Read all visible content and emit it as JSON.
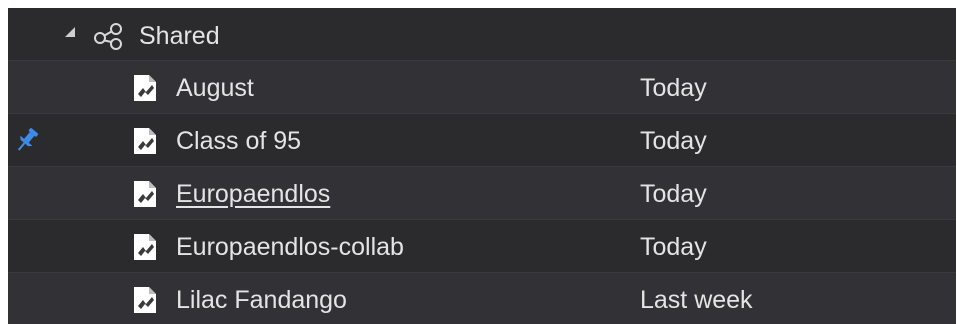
{
  "group": {
    "label": "Shared",
    "disclosure_icon": "triangle-expanded",
    "icon": "share-icon",
    "expanded": true
  },
  "rows": [
    {
      "name": "August",
      "date": "Today",
      "pinned": false,
      "link": false,
      "icon": "document-icon"
    },
    {
      "name": "Class of 95",
      "date": "Today",
      "pinned": true,
      "link": false,
      "icon": "document-icon"
    },
    {
      "name": "Europaendlos",
      "date": "Today",
      "pinned": false,
      "link": true,
      "icon": "document-icon"
    },
    {
      "name": "Europaendlos-collab",
      "date": "Today",
      "pinned": false,
      "link": false,
      "icon": "document-icon"
    },
    {
      "name": "Lilac Fandango",
      "date": "Last week",
      "pinned": false,
      "link": false,
      "icon": "document-icon"
    }
  ],
  "colors": {
    "background": "#2b2b2e",
    "row_alt": "#323236",
    "text": "#e4e4e4",
    "pin": "#3d8bea"
  }
}
